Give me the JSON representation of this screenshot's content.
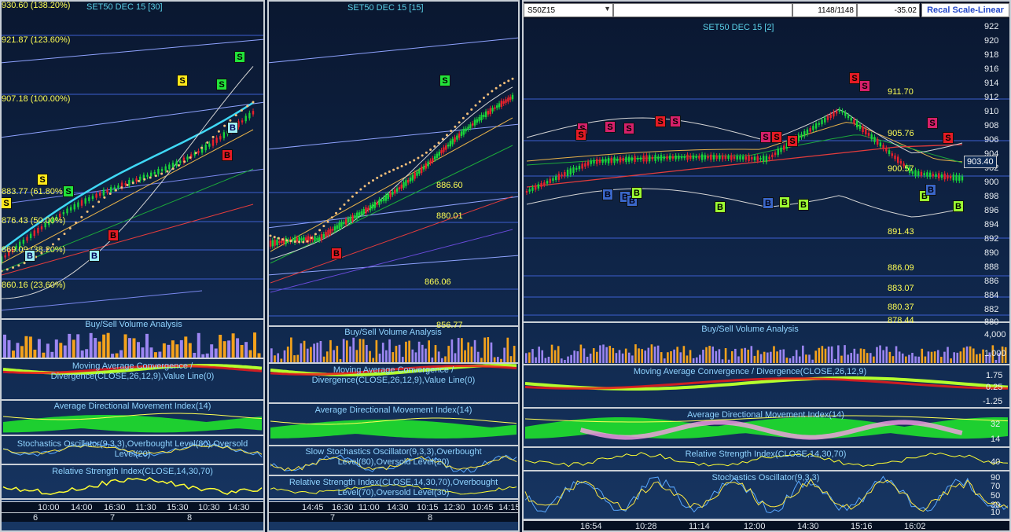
{
  "colors": {
    "up": "#19d43a",
    "down": "#e8212b",
    "cyan": "#3fd8f5",
    "yellow": "#ffff55",
    "fib": "#4f6fd8"
  },
  "pane1": {
    "title": "SET50 DEC 15   [30]",
    "fib_labels": [
      "930.60 (138.20%)",
      "921.87 (123.60%)",
      "907.18 (100.00%)",
      "883.77 (61.80%)",
      "876.43 (50.00%)",
      "869.09 (38.20%)",
      "860.16 (23.60%)"
    ],
    "markers": [
      "S",
      "S",
      "S",
      "S",
      "S",
      "S",
      "B",
      "B",
      "B",
      "B",
      "B",
      "B"
    ],
    "ind_volume": "Buy/Sell Volume Analysis",
    "ind_macd": "Moving Average Convergence /\nDivergence(CLOSE,26,12,9),Value Line(0)",
    "ind_adx": "Average Directional Movement Index(14)",
    "ind_stoch": "Stochastics Oscillator(9,3,3),Overbought Level(80),Oversold\nLevel(20)",
    "ind_rsi": "Relative Strength Index(CLOSE,14,30,70)",
    "times": [
      "10:00",
      "14:00",
      "16:30",
      "11:30",
      "15:30",
      "10:30",
      "14:30"
    ],
    "dates": [
      "6",
      "7",
      "8"
    ]
  },
  "pane2": {
    "title": "SET50 DEC 15   [15]",
    "levels": [
      "886.60",
      "880.01",
      "866.06",
      "856.77"
    ],
    "markers": [
      "S",
      "B"
    ],
    "ind_volume": "Buy/Sell Volume Analysis",
    "ind_macd": "Moving Average Convergence /\nDivergence(CLOSE,26,12,9),Value Line(0)",
    "ind_adx": "Average Directional Movement Index(14)",
    "ind_stoch": "Slow Stochastics Oscillator(9,3,3),Overbought\nLevel(80),Oversold Level(20)",
    "ind_rsi": "Relative Strength Index(CLOSE,14,30,70),Overbought\nLevel(70),Oversold Level(30)",
    "times": [
      "14:45",
      "16:30",
      "11:00",
      "14:30",
      "10:15",
      "12:30",
      "10:45",
      "14:15"
    ],
    "dates": [
      "7",
      "8"
    ]
  },
  "pane3": {
    "symbol": "S50Z15",
    "bar_count": "1148/1148",
    "change": "-35.02",
    "recal_label": "Recal Scale-Linear",
    "title": "SET50 DEC 15   [2]",
    "current_price": "903.40",
    "levels": [
      "911.70",
      "905.76",
      "900.57",
      "891.43",
      "886.09",
      "883.07",
      "880.37",
      "878.44"
    ],
    "price_axis": [
      "922",
      "920",
      "918",
      "916",
      "914",
      "912",
      "910",
      "908",
      "906",
      "904",
      "902",
      "900",
      "898",
      "896",
      "894",
      "892",
      "890",
      "888",
      "886",
      "884",
      "882",
      "880"
    ],
    "markers_s": [
      "S",
      "S",
      "S",
      "S",
      "S",
      "S",
      "S",
      "S",
      "S",
      "S",
      "S",
      "S",
      "S",
      "S"
    ],
    "markers_b": [
      "B",
      "B",
      "B",
      "B",
      "B",
      "B",
      "B",
      "B",
      "B",
      "B",
      "B",
      "B"
    ],
    "ind_volume": "Buy/Sell Volume Analysis",
    "vol_axis": [
      "4,000",
      "1,000"
    ],
    "ind_macd": "Moving Average Convergence / Divergence(CLOSE,26,12,9)",
    "macd_axis": [
      "1.75",
      "0.25",
      "-1.25"
    ],
    "ind_adx": "Average Directional Movement Index(14)",
    "adx_axis": [
      "32",
      "14"
    ],
    "ind_rsi": "Relative Strength Index(CLOSE,14,30,70)",
    "rsi_axis": [
      "40"
    ],
    "ind_stoch": "Stochastics Oscillator(9,3,3)",
    "stoch_axis": [
      "90",
      "70",
      "50",
      "30",
      "10"
    ],
    "times": [
      "16:54",
      "10:28",
      "11:14",
      "12:00",
      "14:30",
      "15:16",
      "16:02"
    ]
  }
}
